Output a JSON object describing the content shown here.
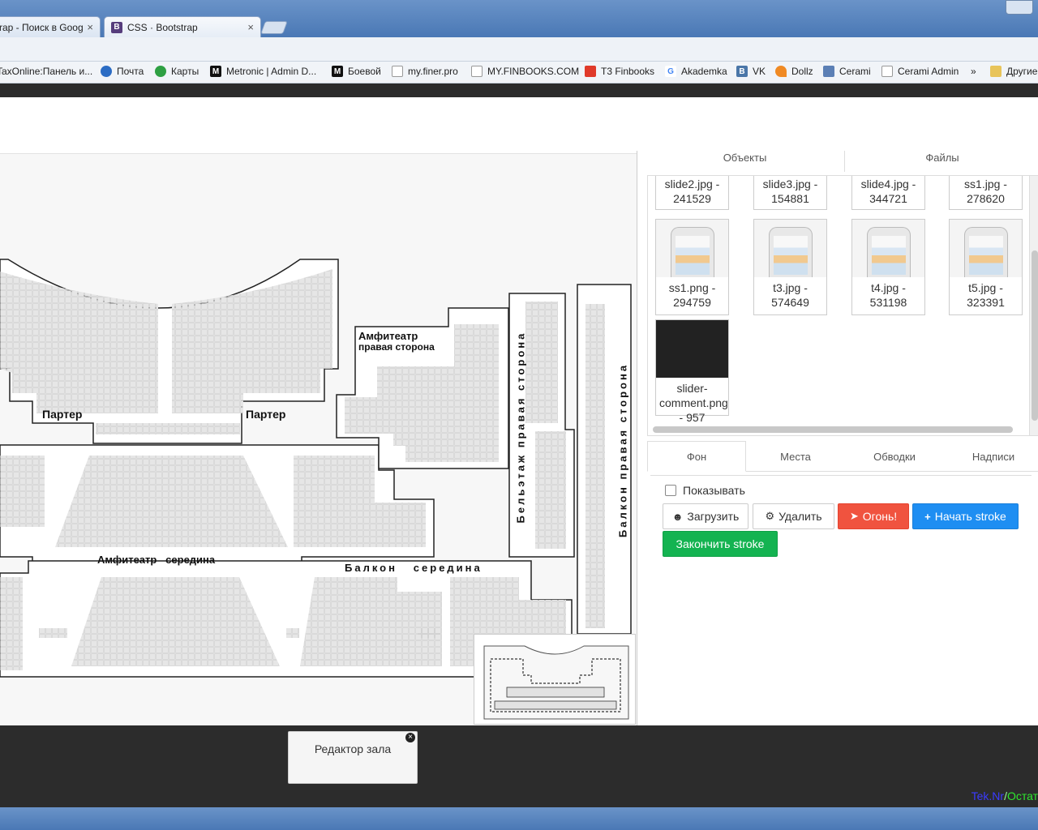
{
  "browser": {
    "tabs": [
      {
        "title": "rap - Поиск в Goog",
        "icon": "google-icon"
      },
      {
        "title": "CSS · Bootstrap",
        "icon": "bootstrap-icon",
        "favicon_letter": "B"
      }
    ],
    "tab_close": "×",
    "bookmarks": [
      {
        "label": "TaxOnline:Панель и..."
      },
      {
        "label": "Почта",
        "icon": "mail-icon"
      },
      {
        "label": "Карты",
        "icon": "maps-icon"
      },
      {
        "label": "Metronic | Admin D...",
        "icon": "metronic-icon",
        "favicon_letter": "M"
      },
      {
        "label": "Боевой",
        "icon": "metronic-icon",
        "favicon_letter": "M"
      },
      {
        "label": "my.finer.pro",
        "icon": "page-icon"
      },
      {
        "label": "MY.FINBOOKS.COM",
        "icon": "page-icon"
      },
      {
        "label": "T3 Finbooks",
        "icon": "pdf-icon"
      },
      {
        "label": "Akademka",
        "icon": "google-icon",
        "favicon_letter": "G"
      },
      {
        "label": "VK",
        "icon": "vk-icon",
        "favicon_letter": "B"
      },
      {
        "label": "Dollz",
        "icon": "carrot-icon"
      },
      {
        "label": "Cerami",
        "icon": "cerami-icon"
      },
      {
        "label": "Cerami Admin",
        "icon": "page-icon"
      },
      {
        "label": "»"
      },
      {
        "label": "Другие",
        "icon": "folder-icon"
      }
    ]
  },
  "hall": {
    "labels": {
      "parter_left": "Партер",
      "parter_right": "Партер",
      "amph_right_title": "Амфитеатр",
      "amph_right_sub": "правая сторона",
      "amph_middle": "Амфитеатр   середина",
      "balcony_middle": "Балкон   середина",
      "mezz_right": "Бельэтаж правая сторона",
      "balcony_right": "Балкон правая сторона"
    }
  },
  "panel": {
    "top_tabs": [
      "Объекты",
      "Файлы"
    ],
    "files": [
      {
        "name": "slide2.jpg - 241529"
      },
      {
        "name": "slide3.jpg - 154881"
      },
      {
        "name": "slide4.jpg - 344721"
      },
      {
        "name": "ss1.jpg - 278620"
      },
      {
        "name": "ss1.png - 294759"
      },
      {
        "name": "t3.jpg - 574649"
      },
      {
        "name": "t4.jpg - 531198"
      },
      {
        "name": "t5.jpg - 323391"
      },
      {
        "name": "slider-comment.png - 957"
      }
    ],
    "bottom_tabs": [
      "Фон",
      "Места",
      "Обводки",
      "Надписи"
    ],
    "show_label": "Показывать",
    "buttons": {
      "upload": "Загрузить",
      "delete": "Удалить",
      "fire": "Огонь!",
      "start_stroke": "Начать stroke",
      "finish_stroke": "Закончить stroke"
    }
  },
  "notice": {
    "title": "Редактор зала",
    "close": "×"
  },
  "credit": {
    "part1": "Tek.Nr",
    "sep": "/",
    "part2": "Остат"
  },
  "colors": {
    "danger": "#f0533f",
    "primary": "#1e8ef2",
    "success": "#14b351",
    "footer": "#2c2c2c"
  }
}
